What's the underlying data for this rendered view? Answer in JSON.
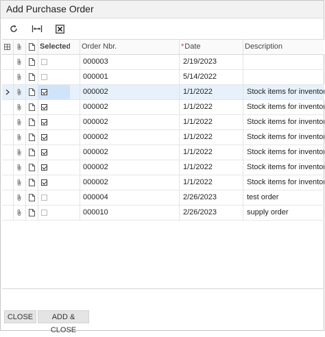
{
  "dialog": {
    "title": "Add Purchase Order"
  },
  "toolbar": {
    "buttons": [
      {
        "name": "refresh-button",
        "icon": "refresh-icon"
      },
      {
        "name": "fit-columns-button",
        "icon": "fit-columns-icon"
      },
      {
        "name": "export-excel-button",
        "icon": "excel-icon"
      }
    ]
  },
  "grid": {
    "columns": {
      "selected": "Selected",
      "order_nbr": "Order Nbr.",
      "date_required_mark": "*",
      "date": "Date",
      "description": "Description"
    },
    "rows": [
      {
        "selected": false,
        "order_nbr": "000003",
        "date": "2/19/2023",
        "description": "",
        "active": false
      },
      {
        "selected": false,
        "order_nbr": "000001",
        "date": "5/14/2022",
        "description": "",
        "active": false
      },
      {
        "selected": true,
        "order_nbr": "000002",
        "date": "1/1/2022",
        "description": "Stock items for inventory",
        "active": true
      },
      {
        "selected": true,
        "order_nbr": "000002",
        "date": "1/1/2022",
        "description": "Stock items for inventory",
        "active": false
      },
      {
        "selected": true,
        "order_nbr": "000002",
        "date": "1/1/2022",
        "description": "Stock items for inventory",
        "active": false
      },
      {
        "selected": true,
        "order_nbr": "000002",
        "date": "1/1/2022",
        "description": "Stock items for inventory",
        "active": false
      },
      {
        "selected": true,
        "order_nbr": "000002",
        "date": "1/1/2022",
        "description": "Stock items for inventory",
        "active": false
      },
      {
        "selected": true,
        "order_nbr": "000002",
        "date": "1/1/2022",
        "description": "Stock items for inventory",
        "active": false
      },
      {
        "selected": true,
        "order_nbr": "000002",
        "date": "1/1/2022",
        "description": "Stock items for inventory",
        "active": false
      },
      {
        "selected": false,
        "order_nbr": "000004",
        "date": "2/26/2023",
        "description": "test order",
        "active": false
      },
      {
        "selected": false,
        "order_nbr": "000010",
        "date": "2/26/2023",
        "description": "supply order",
        "active": false
      }
    ]
  },
  "footer": {
    "close_label": "CLOSE",
    "add_close_label": "ADD & CLOSE"
  },
  "colors": {
    "active_row": "#e6f1fb",
    "active_cell": "#cfe4f8",
    "required_mark": "#d23b3b"
  }
}
